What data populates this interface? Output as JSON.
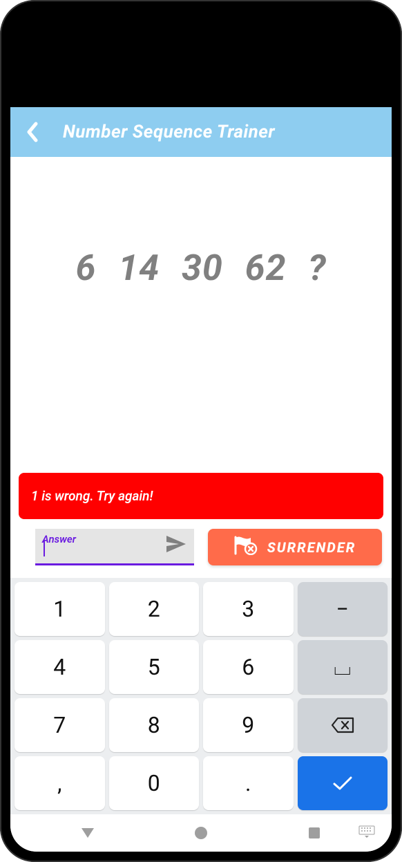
{
  "header": {
    "title": "Number Sequence Trainer"
  },
  "sequence_display": "6  14  30  62  ?",
  "error_message": "1 is wrong. Try again!",
  "answer": {
    "label": "Answer",
    "value": ""
  },
  "surrender_label": "SURRENDER",
  "keypad": {
    "k1": "1",
    "k2": "2",
    "k3": "3",
    "k4": "4",
    "k5": "5",
    "k6": "6",
    "k7": "7",
    "k8": "8",
    "k9": "9",
    "k0": "0",
    "kcomma": ",",
    "kdot": ".",
    "kminus": "−",
    "kspace": "⌴"
  },
  "colors": {
    "header_bg": "#8ecdf0",
    "error_bg": "#ff0000",
    "accent": "#6a1be0",
    "surrender_bg": "#ff6b4a",
    "confirm_bg": "#1a73e8"
  }
}
